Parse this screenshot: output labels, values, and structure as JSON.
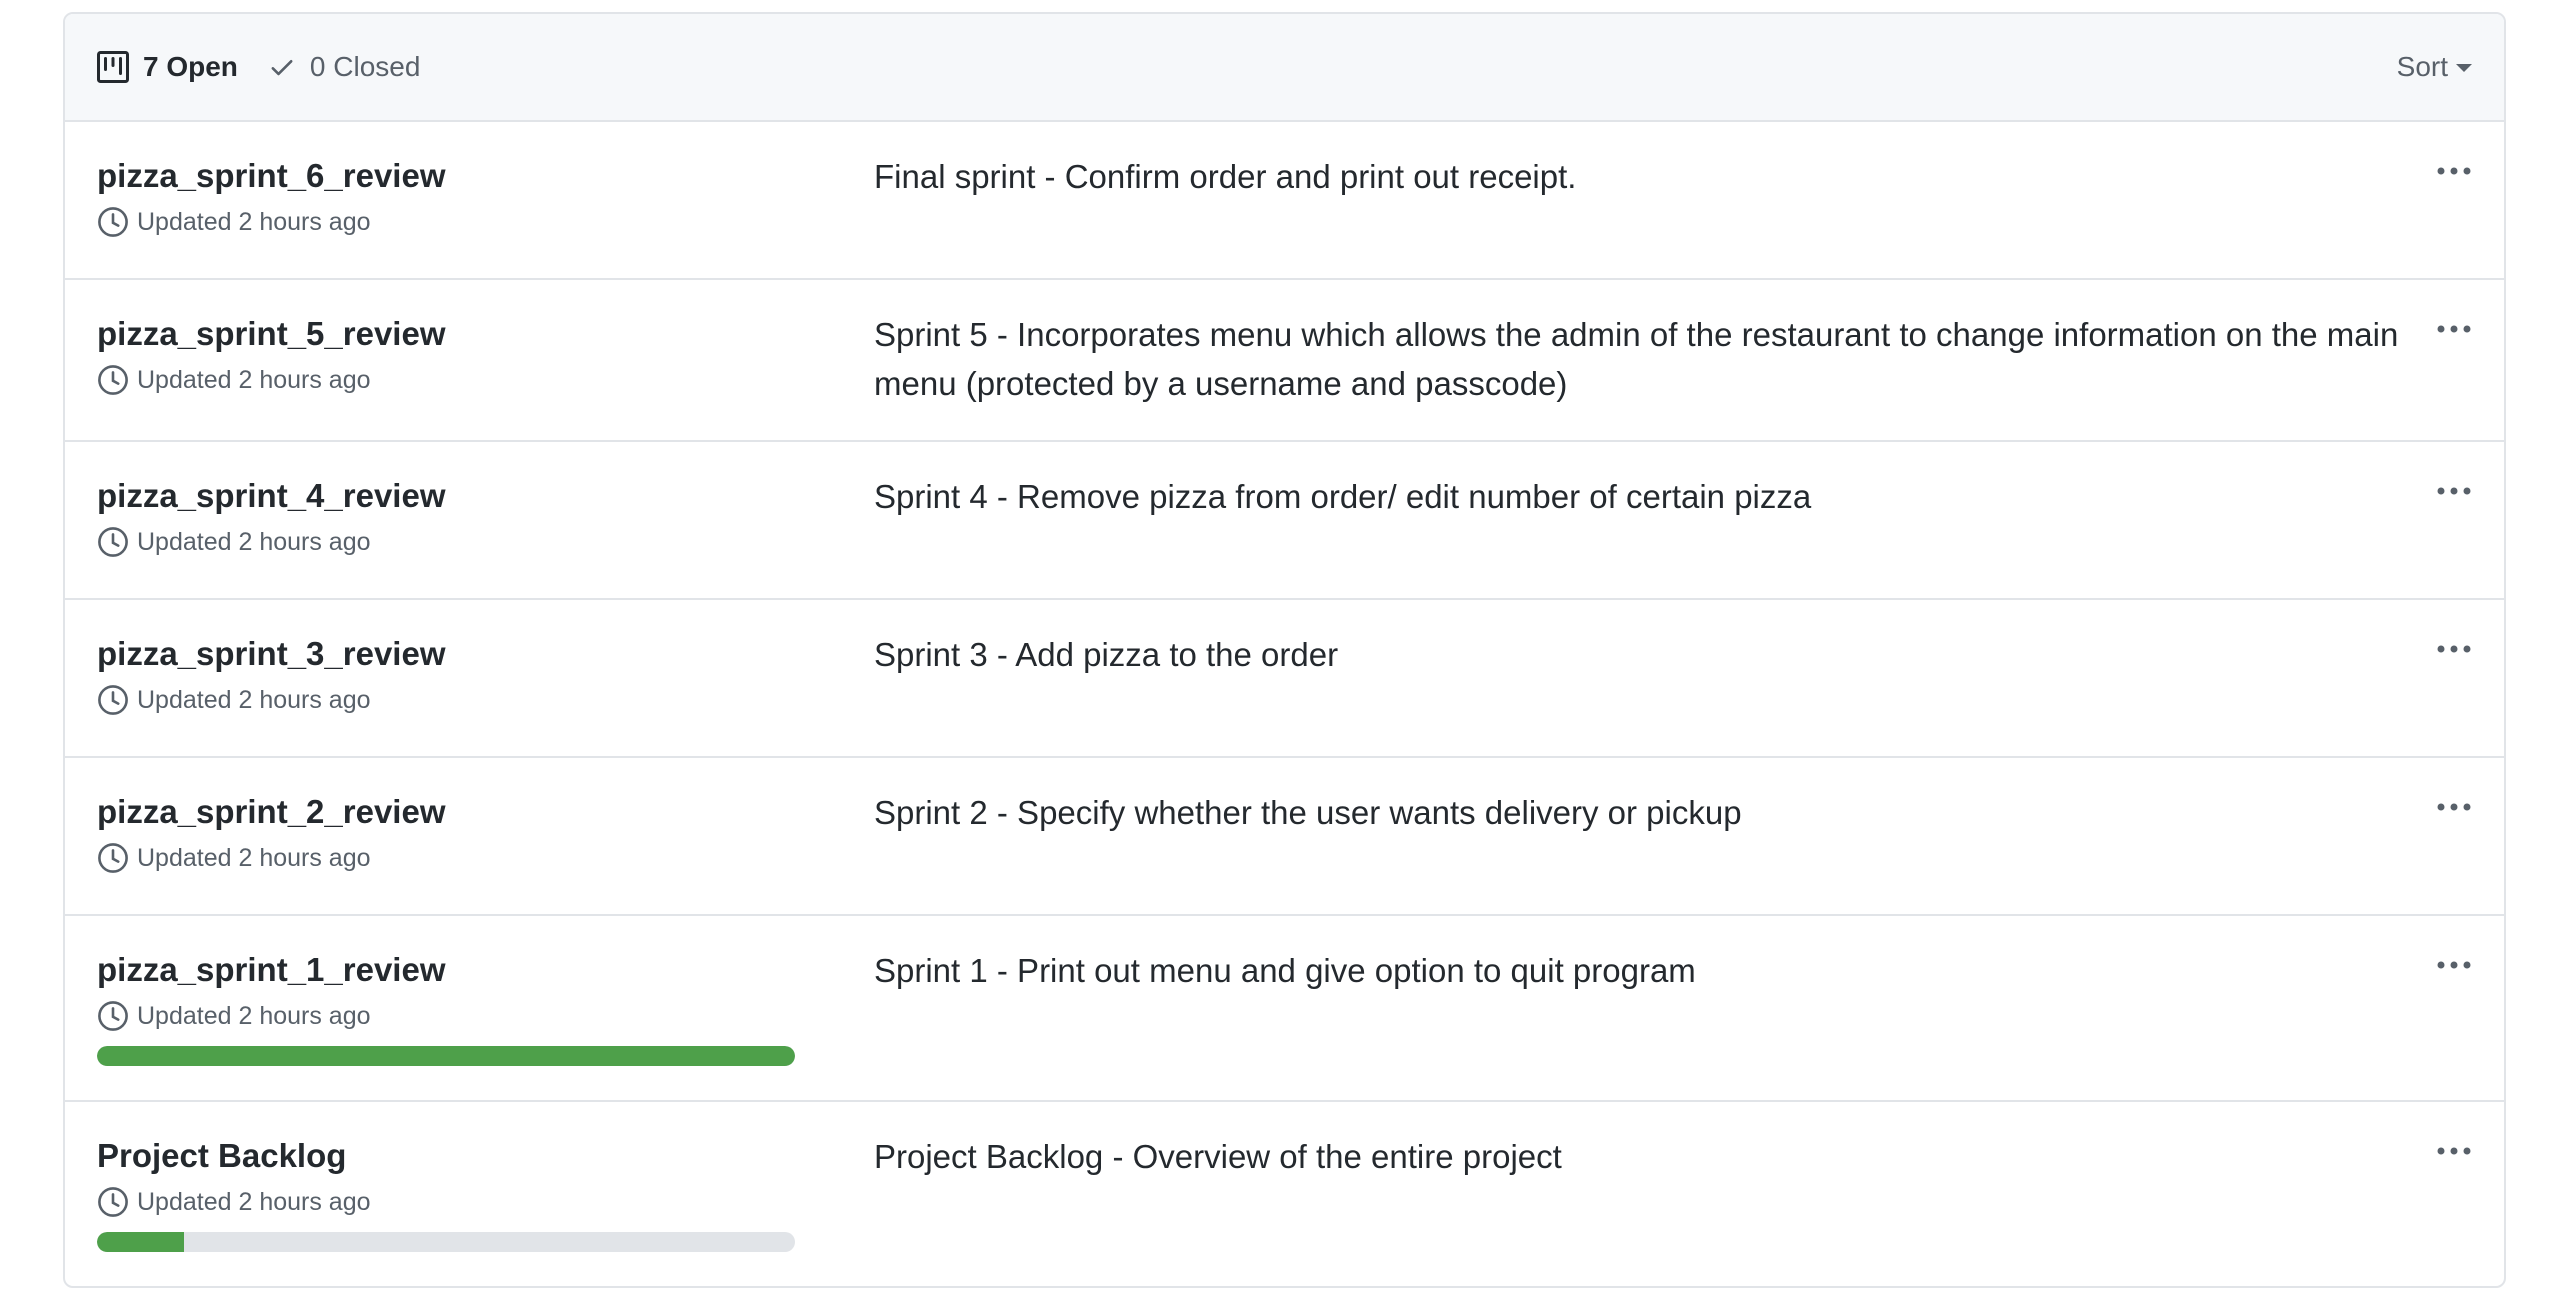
{
  "header": {
    "open_label": "7 Open",
    "closed_label": "0 Closed",
    "sort_label": "Sort"
  },
  "projects": [
    {
      "title": "pizza_sprint_6_review",
      "updated": "Updated 2 hours ago",
      "description": "Final sprint - Confirm order and print out receipt."
    },
    {
      "title": "pizza_sprint_5_review",
      "updated": "Updated 2 hours ago",
      "description": "Sprint 5 - Incorporates menu which allows the admin of the restaurant to change information on the main menu (protected by a username and passcode)"
    },
    {
      "title": "pizza_sprint_4_review",
      "updated": "Updated 2 hours ago",
      "description": "Sprint 4 - Remove pizza from order/ edit number of certain pizza"
    },
    {
      "title": "pizza_sprint_3_review",
      "updated": "Updated 2 hours ago",
      "description": "Sprint 3 - Add pizza to the order"
    },
    {
      "title": "pizza_sprint_2_review",
      "updated": "Updated 2 hours ago",
      "description": "Sprint 2 - Specify whether the user wants delivery or pickup"
    },
    {
      "title": "pizza_sprint_1_review",
      "updated": "Updated 2 hours ago",
      "description": "Sprint 1 - Print out menu and give option to quit program",
      "progress_fraction": 1.0
    },
    {
      "title": "Project Backlog",
      "updated": "Updated 2 hours ago",
      "description": "Project Backlog - Overview of the entire project",
      "progress_fraction": 0.125
    }
  ],
  "colors": {
    "progress_fill": "#4ea04a",
    "progress_track": "#e1e4e8",
    "border": "#e1e4e8",
    "header_bg": "#f6f8fa",
    "muted_text": "#586069"
  },
  "icons": {
    "open": "project-board-icon",
    "closed": "check-icon",
    "updated": "clock-icon",
    "more": "kebab-horizontal-icon"
  }
}
